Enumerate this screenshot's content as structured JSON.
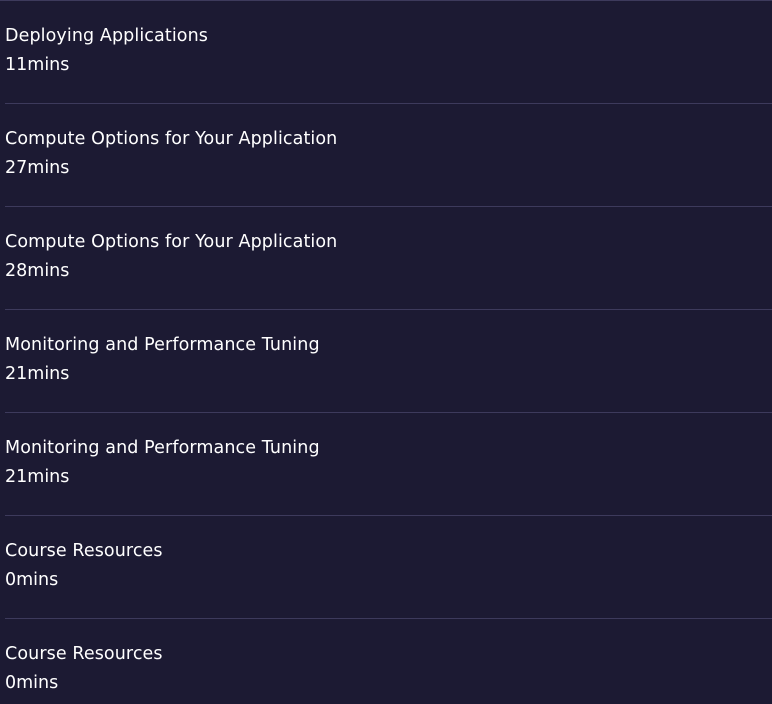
{
  "course_contents": {
    "items": [
      {
        "title": "Deploying Applications",
        "duration": "11mins"
      },
      {
        "title": "Compute Options for Your Application",
        "duration": "27mins"
      },
      {
        "title": "Compute Options for Your Application",
        "duration": "28mins"
      },
      {
        "title": "Monitoring and Performance Tuning",
        "duration": "21mins"
      },
      {
        "title": "Monitoring and Performance Tuning",
        "duration": "21mins"
      },
      {
        "title": "Course Resources",
        "duration": "0mins"
      },
      {
        "title": "Course Resources",
        "duration": "0mins"
      }
    ]
  },
  "colors": {
    "background": "#1c1a33",
    "divider": "#3d3a5c",
    "text": "#ffffff"
  }
}
